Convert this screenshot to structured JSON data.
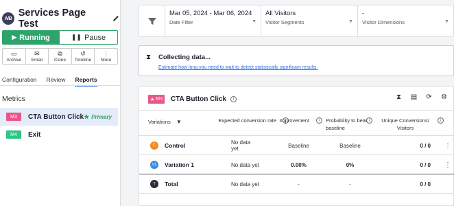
{
  "test": {
    "avatar": "A/B",
    "title": "Services Page Test"
  },
  "status": {
    "running": "Running",
    "pause": "Pause"
  },
  "tools": [
    {
      "icon": "archive-icon",
      "label": "Archive"
    },
    {
      "icon": "email-icon",
      "label": "Email"
    },
    {
      "icon": "clone-icon",
      "label": "Clone"
    },
    {
      "icon": "timeline-icon",
      "label": "Timeline"
    },
    {
      "icon": "more-icon",
      "label": "More"
    }
  ],
  "tabs": [
    "Configuration",
    "Review",
    "Reports"
  ],
  "active_tab": "Reports",
  "metrics": {
    "heading": "Metrics",
    "items": [
      {
        "badge": "M3",
        "name": "CTA Button Click",
        "primary": "Primary",
        "selected": true
      },
      {
        "badge": "M4",
        "name": "Exit"
      }
    ]
  },
  "filters": [
    {
      "value": "Mar 05, 2024 - Mar 06, 2024",
      "label": "Date Filter"
    },
    {
      "value": "All Visitors",
      "label": "Visitor Segments"
    },
    {
      "value": "-",
      "label": "Visitor Dimensions"
    }
  ],
  "collecting": {
    "title": "Collecting data...",
    "link": "Estimate how long you need to wait to detect statistically significant results."
  },
  "report": {
    "badge": "M3",
    "title": "CTA Button Click",
    "columns": {
      "variations": "Variations",
      "expected": "Expected conversion rate",
      "improvement": "Improvement",
      "probability": "Probability to beat baseline",
      "unique": "Unique Conversions/ Visitors"
    },
    "rows": [
      {
        "dot": "C",
        "color": "#f08a24",
        "name": "Control",
        "expected": "No data yet",
        "improvement": "Baseline",
        "probability": "Baseline",
        "unique": "0 / 0"
      },
      {
        "dot": "V1",
        "color": "#3a8de0",
        "name": "Variation 1",
        "expected": "No data yet",
        "improvement": "0.00%",
        "probability": "0%",
        "unique": "0 / 0"
      },
      {
        "dot": "T",
        "color": "#2b2f3a",
        "name": "Total",
        "expected": "No data yet",
        "improvement": "-",
        "probability": "-",
        "unique": "0 / 0"
      }
    ]
  },
  "colors": {
    "running": "#2ea36b",
    "m3": "#e8578a",
    "m4": "#2ec587",
    "link": "#2f6fd6"
  }
}
